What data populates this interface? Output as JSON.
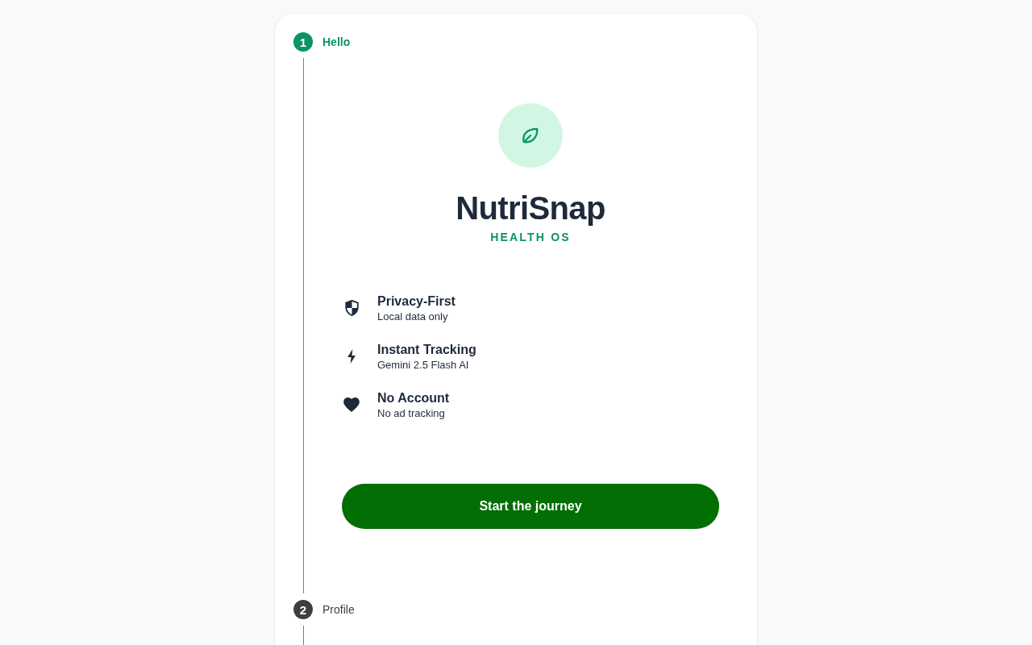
{
  "stepper": {
    "steps": [
      {
        "number": "1",
        "label": "Hello",
        "selected": true,
        "content": {
          "app_name": "NutriSnap",
          "tagline": "HEALTH OS",
          "features": [
            {
              "title": "Privacy-First",
              "subtitle": "Local data only"
            },
            {
              "title": "Instant Tracking",
              "subtitle": "Gemini 2.5 Flash AI"
            },
            {
              "title": "No Account",
              "subtitle": "No ad tracking"
            }
          ],
          "button": "Start the journey"
        }
      },
      {
        "number": "2",
        "label": "Profile",
        "selected": false
      }
    ]
  }
}
